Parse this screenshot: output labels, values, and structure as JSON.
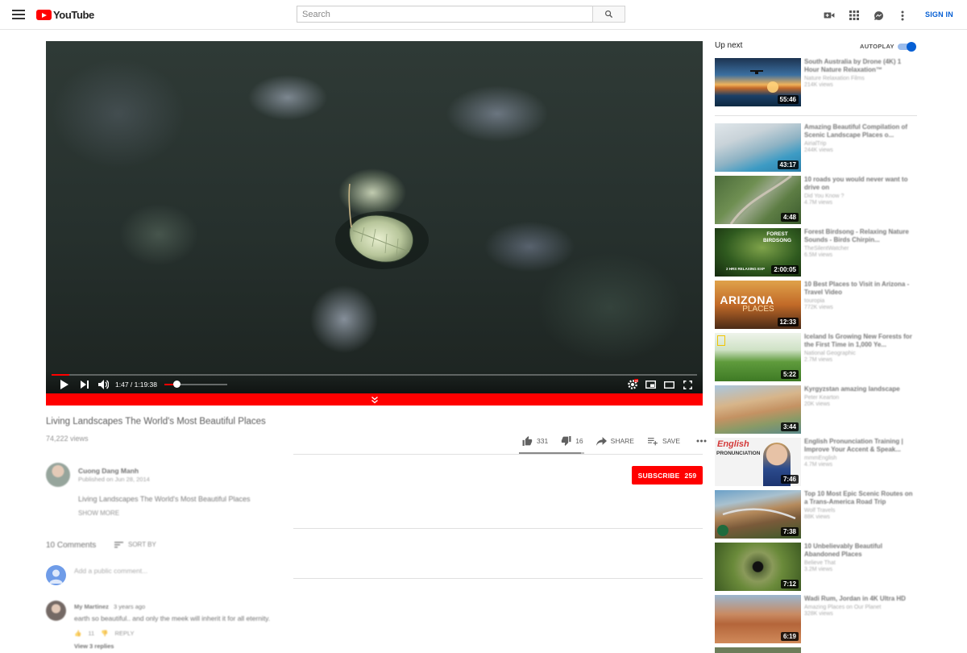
{
  "header": {
    "logo_text": "YouTube",
    "search_placeholder": "Search",
    "sign_in": "SIGN IN",
    "icons": [
      "menu-icon",
      "create-video-icon",
      "apps-grid-icon",
      "messages-icon",
      "more-vert-icon",
      "search-icon"
    ]
  },
  "player": {
    "time_display": "1:47 / 1:19:38",
    "progress_fraction": 0.027,
    "volume_fraction": 0.19,
    "icons": [
      "play-icon",
      "next-icon",
      "volume-icon",
      "settings-icon",
      "miniplayer-icon",
      "theater-icon",
      "fullscreen-icon"
    ],
    "hd_badge": "HD"
  },
  "video": {
    "title": "Living Landscapes The World's Most Beautiful Places",
    "views": "74,222 views",
    "likes": "331",
    "dislikes": "16",
    "share_label": "SHARE",
    "save_label": "SAVE",
    "like_fraction": 0.954
  },
  "owner": {
    "name": "Cuong Dang Manh",
    "published": "Published on Jun 28, 2014",
    "description": "Living Landscapes The World's Most Beautiful Places",
    "show_more": "SHOW MORE",
    "subscribe_label": "SUBSCRIBE",
    "subscriber_count": "259"
  },
  "comments": {
    "count_label": "10 Comments",
    "sort_label": "SORT BY",
    "add_placeholder": "Add a public comment...",
    "first": {
      "author": "My Martinez",
      "age": "3 years ago",
      "text": "earth so beautiful.. and only the meek will inherit it for all eternity.",
      "likes": "11",
      "reply_label": "REPLY",
      "view_replies": "View 3 replies"
    }
  },
  "sidebar": {
    "up_next_label": "Up next",
    "autoplay_label": "AUTOPLAY",
    "autoplay_on": true,
    "items": [
      {
        "title": "South Australia by Drone (4K) 1 Hour Nature Relaxation™",
        "channel": "Nature Relaxation Films",
        "views": "214K views",
        "duration": "55:46"
      },
      {
        "title": "Amazing Beautiful Compilation of Scenic Landscape Places o...",
        "channel": "AirialTrip",
        "views": "244K views",
        "duration": "43:17"
      },
      {
        "title": "10 roads you would never want to drive on",
        "channel": "Did You Know ?",
        "views": "4.7M views",
        "duration": "4:48"
      },
      {
        "title": "Forest Birdsong - Relaxing Nature Sounds - Birds Chirpin...",
        "channel": "TheSilentWatcher",
        "views": "6.5M views",
        "duration": "2:00:05"
      },
      {
        "title": "10 Best Places to Visit in Arizona - Travel Video",
        "channel": "touropia",
        "views": "772K views",
        "duration": "12:33"
      },
      {
        "title": "Iceland Is Growing New Forests for the First Time in 1,000 Ye...",
        "channel": "National Geographic",
        "views": "2.7M views",
        "duration": "5:22"
      },
      {
        "title": "Kyrgyzstan amazing landscape",
        "channel": "Peter Kearton",
        "views": "20K views",
        "duration": "3:44"
      },
      {
        "title": "English Pronunciation Training | Improve Your Accent & Speak...",
        "channel": "mmmEnglish",
        "views": "4.7M views",
        "duration": "7:46"
      },
      {
        "title": "Top 10 Most Epic Scenic Routes on a Trans-America Road Trip",
        "channel": "Wolf Travels",
        "views": "88K views",
        "duration": "7:38"
      },
      {
        "title": "10 Unbelievably Beautiful Abandoned Places",
        "channel": "Believe That",
        "views": "3.2M views",
        "duration": "7:12"
      },
      {
        "title": "Wadi Rum, Jordan in 4K Ultra HD",
        "channel": "Amazing Places on Our Planet",
        "views": "328K views",
        "duration": "6:19"
      }
    ],
    "thumb_text": {
      "forest": "FOREST BIRDSONG",
      "forest_sub": "2 HRS RELAXING EXP",
      "arizona": "ARIZONA",
      "arizona_sub": "PLACES",
      "english": "English",
      "english_sub": "PRONUNCIATION"
    }
  }
}
